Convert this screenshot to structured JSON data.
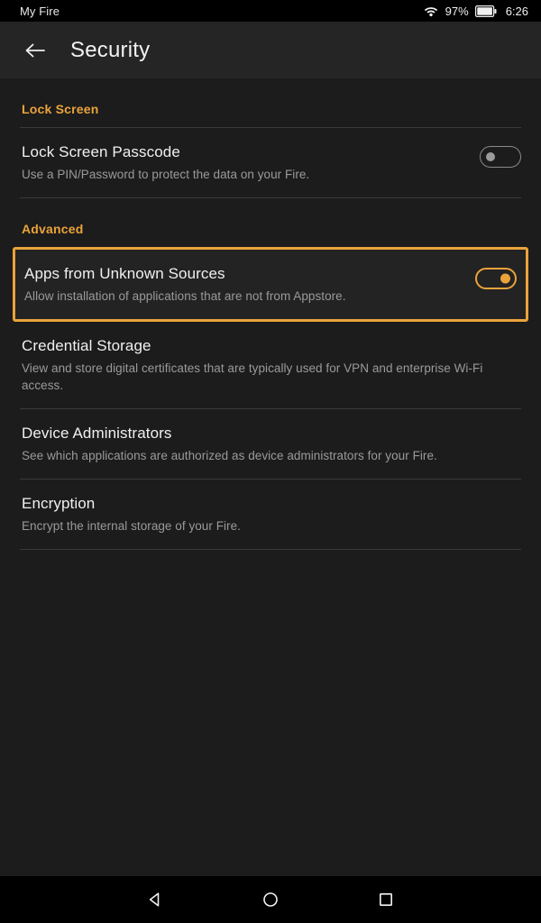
{
  "status_bar": {
    "device_label": "My Fire",
    "wifi_icon": "wifi-full-icon",
    "battery_percent": "97%",
    "battery_icon": "battery-full-icon",
    "clock": "6:26"
  },
  "header": {
    "back_icon": "arrow-left-icon",
    "title": "Security"
  },
  "colors": {
    "accent": "#eba33a",
    "background": "#1c1c1c",
    "header_background": "#252525",
    "title_text": "#f0f0f0",
    "subtitle_text": "#9a9a9a",
    "divider": "#3a3a3a"
  },
  "sections": [
    {
      "label": "Lock Screen",
      "rows": [
        {
          "title": "Lock Screen Passcode",
          "subtitle": "Use a PIN/Password to protect the data on your Fire.",
          "control": "toggle",
          "toggle_state": "off",
          "focused": false
        }
      ]
    },
    {
      "label": "Advanced",
      "rows": [
        {
          "title": "Apps from Unknown Sources",
          "subtitle": "Allow installation of applications that are not from Appstore.",
          "control": "toggle",
          "toggle_state": "on",
          "focused": true
        },
        {
          "title": "Credential Storage",
          "subtitle": "View and store digital certificates that are typically used for VPN and enterprise Wi-Fi access.",
          "control": "none",
          "toggle_state": "",
          "focused": false
        },
        {
          "title": "Device Administrators",
          "subtitle": "See which applications are authorized as device administrators for your Fire.",
          "control": "none",
          "toggle_state": "",
          "focused": false
        },
        {
          "title": "Encryption",
          "subtitle": "Encrypt the internal storage of your Fire.",
          "control": "none",
          "toggle_state": "",
          "focused": false
        }
      ]
    }
  ],
  "nav_bar": {
    "back_icon": "triangle-back-icon",
    "home_icon": "circle-home-icon",
    "recents_icon": "square-recents-icon"
  }
}
